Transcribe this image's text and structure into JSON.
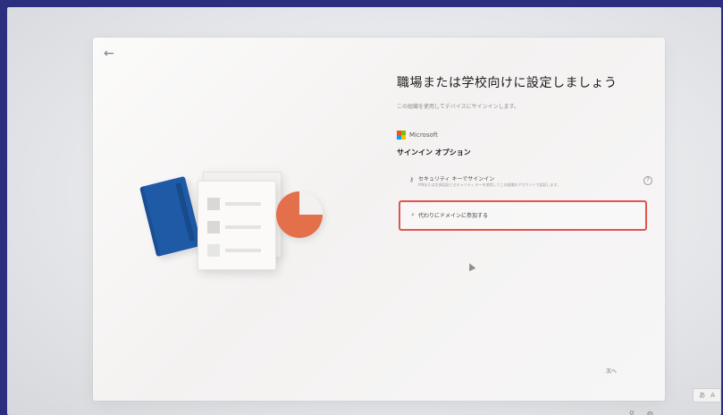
{
  "page": {
    "title": "職場または学校向けに設定しましょう",
    "subtitle": "この組織を使用してデバイスにサインインします。"
  },
  "brand": {
    "name": "Microsoft",
    "logo_colors": [
      "#f25022",
      "#7fba00",
      "#00a4ef",
      "#ffb900"
    ]
  },
  "signin": {
    "section_title": "サインイン オプション",
    "options": [
      {
        "title": "セキュリティ キーでサインイン",
        "description": "PINまたは生体認証とセキュリティ キーを使用してこの組織のアカウントで認証します。",
        "icon": "key-icon"
      },
      {
        "label": "代わりにドメインに参加する",
        "icon": "domain-icon",
        "highlighted": true,
        "highlight_color": "#e2544f"
      }
    ]
  },
  "nav": {
    "back_icon": "back-arrow-icon",
    "next_label": "次へ"
  },
  "tray": {
    "ime_label_1": "あ",
    "ime_label_2": "A"
  },
  "illustration": {
    "book_color": "#1f5aa6",
    "pie_color": "#e46f4b"
  }
}
